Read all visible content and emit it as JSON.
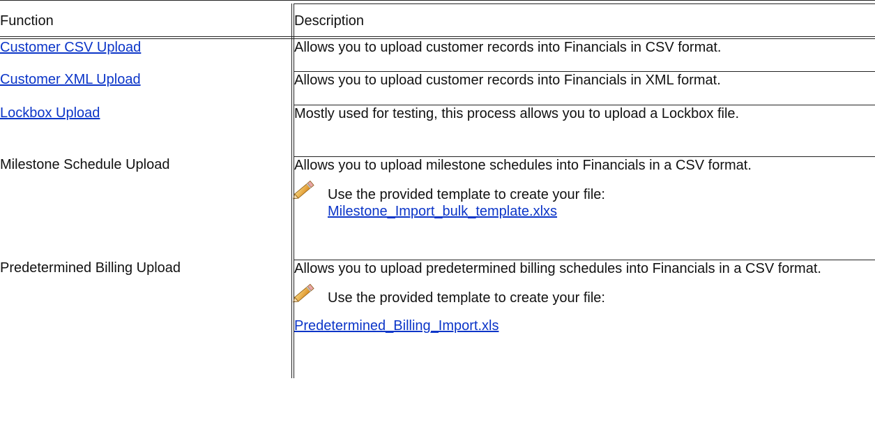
{
  "table": {
    "headers": [
      "Function",
      "Description"
    ],
    "rows": [
      {
        "function": "Customer CSV Upload",
        "function_is_link": true,
        "description": "Allows you to upload customer records into Financials in CSV format."
      },
      {
        "function": "Customer XML Upload",
        "function_is_link": true,
        "description": "Allows you to upload customer records into Financials in XML format."
      },
      {
        "function": "Lockbox Upload",
        "function_is_link": true,
        "description": "Mostly used for testing, this process allows you to upload a Lockbox file."
      },
      {
        "function": "Milestone Schedule Upload",
        "function_is_link": false,
        "description": "Allows you to upload milestone schedules into Financials in a CSV format.",
        "note_icon": "pencil-note-icon",
        "note_text": "Use the provided template to create your file:",
        "note_link": "Milestone_Import_bulk_template.xlxs"
      },
      {
        "function": "Predetermined Billing Upload",
        "function_is_link": false,
        "description": "Allows you to upload predetermined billing schedules into Financials in a CSV format.",
        "note_icon": "pencil-note-icon",
        "note_text": "Use the provided template to create your file:",
        "note_link": "Predetermined_Billing_Import.xls"
      }
    ]
  },
  "colors": {
    "link": "#0b35c8",
    "border": "#222222"
  }
}
